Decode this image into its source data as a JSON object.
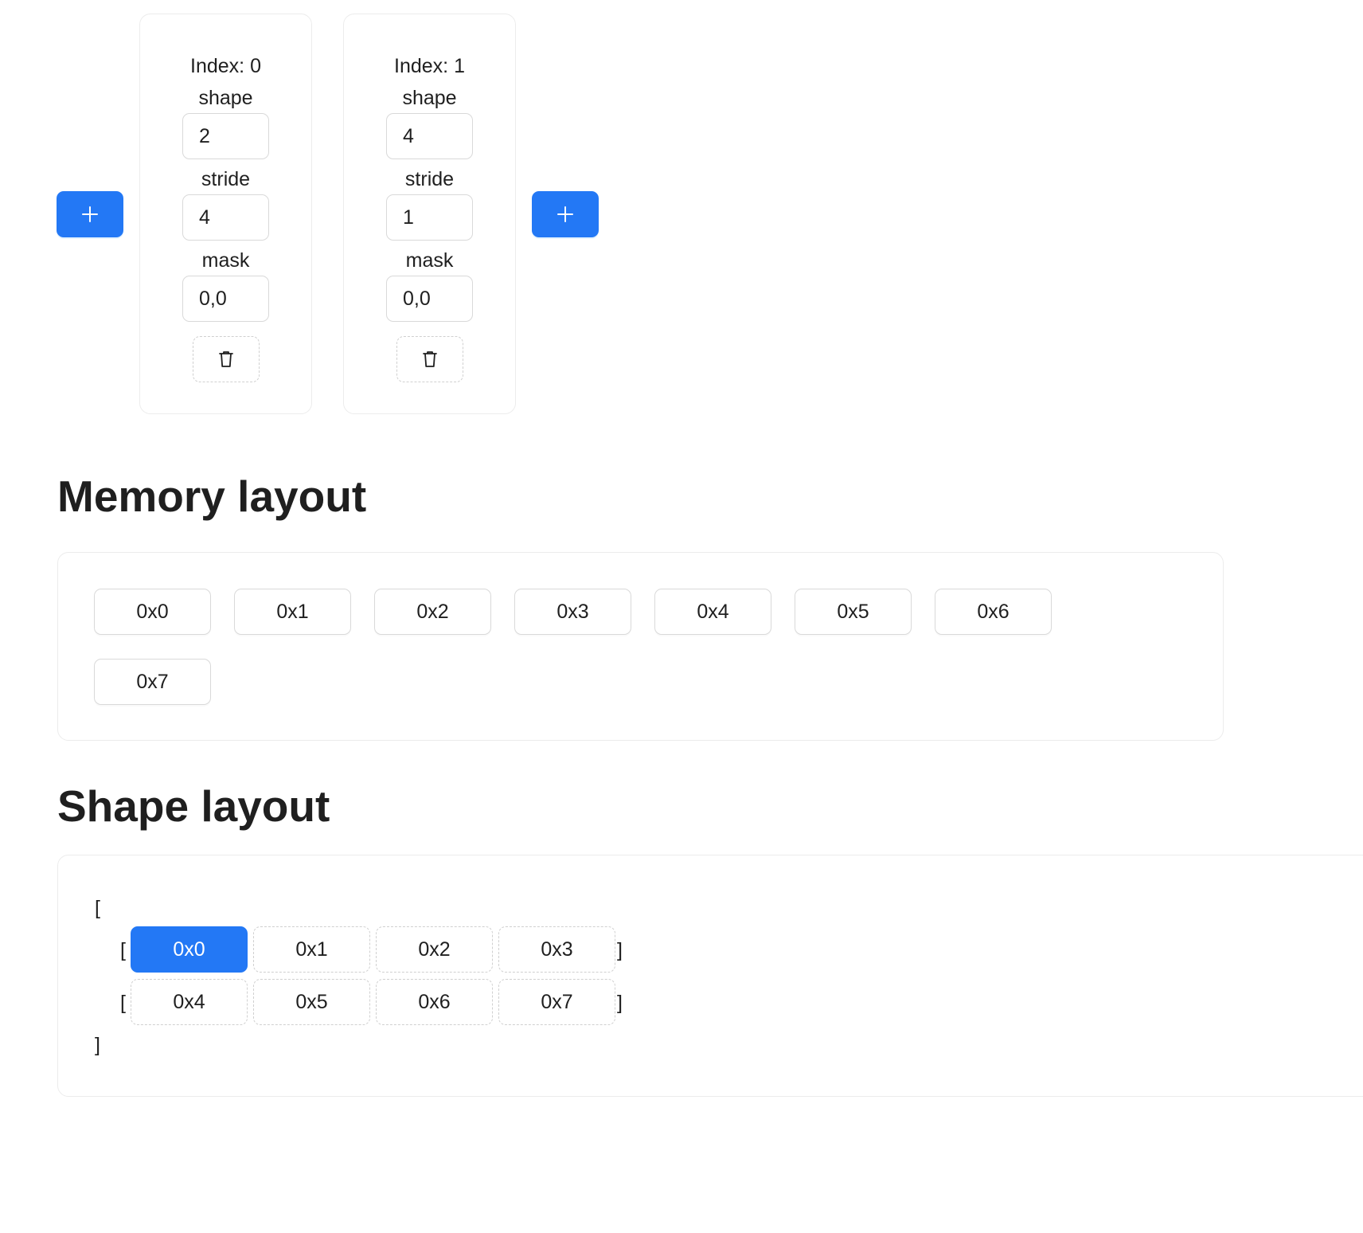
{
  "dimensions": [
    {
      "index_label": "Index: 0",
      "shape_label": "shape",
      "shape_value": "2",
      "stride_label": "stride",
      "stride_value": "4",
      "mask_label": "mask",
      "mask_value": "0,0"
    },
    {
      "index_label": "Index: 1",
      "shape_label": "shape",
      "shape_value": "4",
      "stride_label": "stride",
      "stride_value": "1",
      "mask_label": "mask",
      "mask_value": "0,0"
    }
  ],
  "memory_layout": {
    "title": "Memory layout",
    "cells": [
      "0x0",
      "0x1",
      "0x2",
      "0x3",
      "0x4",
      "0x5",
      "0x6",
      "0x7"
    ]
  },
  "shape_layout": {
    "title": "Shape layout",
    "outer_open": "[",
    "outer_close": "]",
    "row_open": "[",
    "row_close": "]",
    "rows": [
      [
        "0x0",
        "0x1",
        "0x2",
        "0x3"
      ],
      [
        "0x4",
        "0x5",
        "0x6",
        "0x7"
      ]
    ],
    "selected": "0x0"
  },
  "icons": {
    "add": "plus-icon",
    "delete": "trash-icon"
  },
  "colors": {
    "primary": "#2378f5",
    "border": "#d9d9d9",
    "card_border": "#ececec",
    "text": "#1f1f1f"
  }
}
